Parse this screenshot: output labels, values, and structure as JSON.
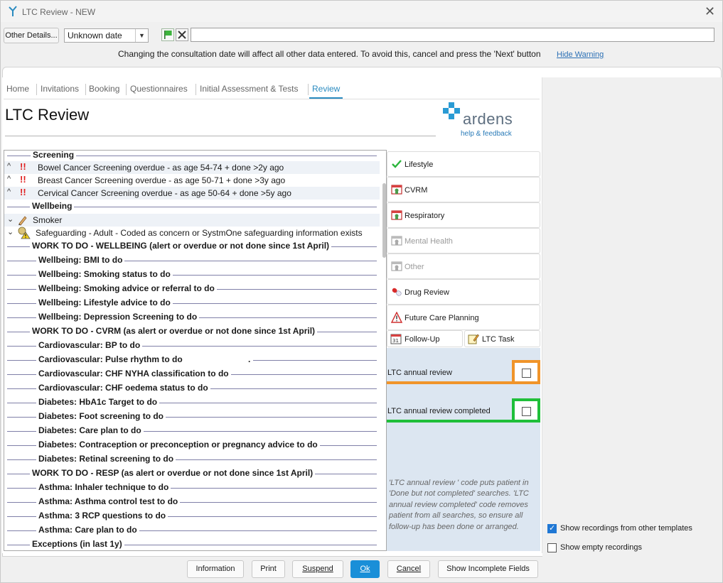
{
  "window": {
    "title": "LTC Review - NEW",
    "close_glyph": "✕"
  },
  "toolbar": {
    "other_details_label": "Other Details...",
    "date_value": "Unknown date",
    "date_arrow": "▼",
    "warning": "Changing the consultation date will affect all other data entered. To avoid this, cancel and press the 'Next' button",
    "hide_warning": "Hide Warning"
  },
  "tabs": [
    {
      "label": "Home"
    },
    {
      "label": "Invitations"
    },
    {
      "label": "Booking"
    },
    {
      "label": "Questionnaires"
    },
    {
      "label": "Initial Assessment & Tests"
    },
    {
      "label": "Review"
    }
  ],
  "page": {
    "title": "LTC Review"
  },
  "logo": {
    "word": "ardens",
    "sub": "help & feedback"
  },
  "list": {
    "screening_header": "Screening",
    "screening_items": [
      "Bowel Cancer Screening overdue - as age 54-74 + done >2y ago",
      "Breast Cancer Screening overdue - as age 50-71 + done >3y ago",
      "Cervical Cancer Screening overdue - as age 50-64 + done >5y ago"
    ],
    "wellbeing_header": "Wellbeing",
    "smoker": "Smoker",
    "safeguarding": "Safeguarding - Adult - Coded as concern or SystmOne safeguarding information exists",
    "wtd_wellbeing": "WORK TO DO - WELLBEING (alert or overdue or not done since 1st April)",
    "wellbeing_todos": [
      "Wellbeing: BMI to do",
      "Wellbeing: Smoking status to do",
      "Wellbeing: Smoking advice or referral to do",
      "Wellbeing: Lifestyle advice to do",
      "Wellbeing: Depression Screening to do"
    ],
    "wtd_cvrm": "WORK TO DO - CVRM (as alert or overdue or not done since 1st April)",
    "cvrm_todos": [
      "Cardiovascular: BP to do",
      "Cardiovascular: Pulse rhythm to do",
      "Cardiovascular: CHF NYHA classification to do",
      "Cardiovascular: CHF oedema status to do",
      "Diabetes: HbA1c Target to do",
      "Diabetes: Foot screening to do",
      "Diabetes: Care plan to do",
      "Diabetes: Contraception or preconception or pregnancy advice to do",
      "Diabetes: Retinal screening to do"
    ],
    "wtd_resp": "WORK TO DO - RESP (as alert or overdue or not done since 1st April)",
    "resp_todos": [
      "Asthma: Inhaler technique to do",
      "Asthma: Asthma control test to do",
      "Asthma: 3 RCP questions to do",
      "Asthma: Care plan to do"
    ],
    "exceptions": "Exceptions (in last 1y)",
    "caret_up": "^",
    "caret_down": "⌄",
    "bang": "!!",
    "stray_dot": "."
  },
  "categories": [
    {
      "label": "Lifestyle",
      "icon": "check-icon"
    },
    {
      "label": "CVRM",
      "icon": "clinic-icon"
    },
    {
      "label": "Respiratory",
      "icon": "clinic-icon"
    },
    {
      "label": "Mental Health",
      "icon": "clinic-icon"
    },
    {
      "label": "Other",
      "icon": "clinic-icon"
    },
    {
      "label": "Drug Review",
      "icon": "pill-icon"
    },
    {
      "label": "Future Care Planning",
      "icon": "warning-icon"
    }
  ],
  "followup": {
    "label": "Follow-Up",
    "icon_text": "31"
  },
  "ltctask": {
    "label": "LTC Task"
  },
  "review": {
    "annual_label": "LTC annual review",
    "annual_color": "#f0942a",
    "completed_label": "LTC annual review completed",
    "completed_color": "#1fbf3a",
    "note": "'LTC annual review ' code puts patient in 'Done but not completed' searches. 'LTC annual review completed' code removes patient from all searches, so ensure all follow-up has been done or arranged."
  },
  "options": {
    "show_other_templates": "Show recordings from other templates",
    "show_empty": "Show empty recordings"
  },
  "buttons": {
    "information": "Information",
    "print": "Print",
    "suspend": "Suspend",
    "ok": "Ok",
    "cancel": "Cancel",
    "show_incomplete": "Show Incomplete Fields"
  }
}
